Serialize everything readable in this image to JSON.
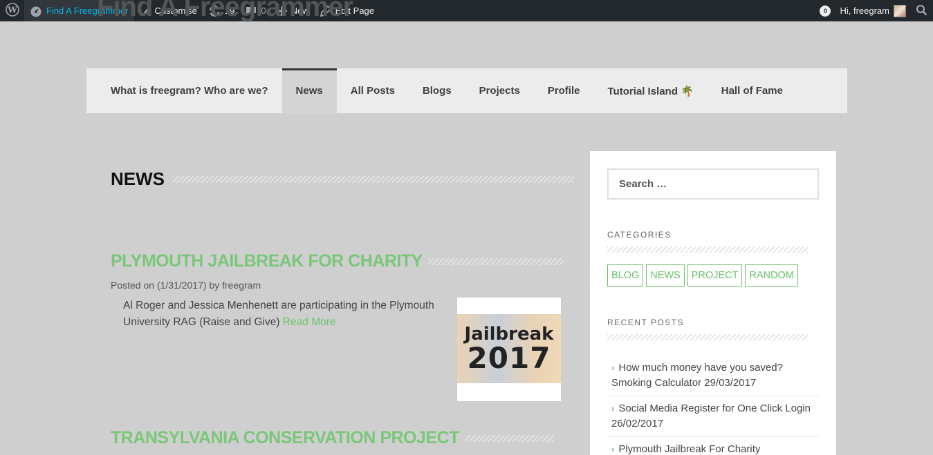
{
  "admin_bar": {
    "site_name": "Find A Freegrammer",
    "customise": "Customise",
    "updates_count": "19",
    "comments_count": "0",
    "new_label": "New",
    "edit_label": "Edit Page",
    "notifications_count": "0",
    "greeting": "Hi, freegram",
    "icons": [
      "wordpress-icon",
      "dashboard-icon",
      "brush-icon",
      "refresh-icon",
      "comment-icon",
      "plus-icon",
      "pencil-icon",
      "search-icon"
    ]
  },
  "site": {
    "title": "Find A Freegrammer"
  },
  "nav": {
    "items": [
      {
        "label": "What is freegram? Who are we?"
      },
      {
        "label": "News"
      },
      {
        "label": "All Posts"
      },
      {
        "label": "Blogs"
      },
      {
        "label": "Projects"
      },
      {
        "label": "Profile"
      },
      {
        "label": "Tutorial Island 🌴"
      },
      {
        "label": "Hall of Fame"
      }
    ],
    "current": "News"
  },
  "main": {
    "heading": "NEWS",
    "posts": [
      {
        "title": "PLYMOUTH JAILBREAK FOR CHARITY",
        "meta_prefix": "Posted on (1/31/2017) by freegram",
        "excerpt": "Al Roger and Jessica Menhenett are participating in the Plymouth University RAG (Raise and Give)",
        "read_more": "Read More",
        "thumb_line1": "Jailbreak",
        "thumb_line2": "2017"
      },
      {
        "title": "TRANSYLVANIA CONSERVATION PROJECT"
      }
    ]
  },
  "sidebar": {
    "search_placeholder": "Search …",
    "categories_title": "CATEGORIES",
    "categories": [
      "BLOG",
      "NEWS",
      "PROJECT",
      "RANDOM"
    ],
    "recent_title": "RECENT POSTS",
    "recent_posts": [
      "How much money have you saved? Smoking Calculator 29/03/2017",
      "Social Media Register for One Click Login 26/02/2017",
      "Plymouth Jailbreak For Charity"
    ]
  },
  "colors": {
    "accent_green": "#7ac77a",
    "admin_bar_bg": "#23282d",
    "admin_link_active": "#00b9eb"
  }
}
